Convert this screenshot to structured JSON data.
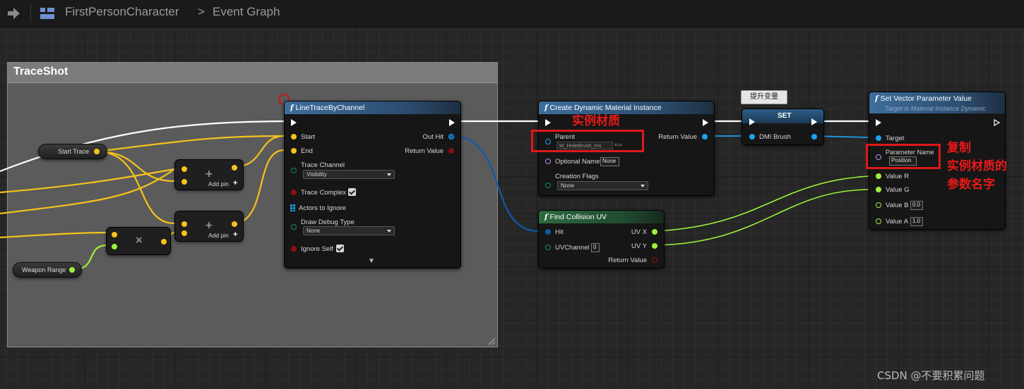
{
  "topbar": {
    "breadcrumb_blueprint": "FirstPersonCharacter",
    "breadcrumb_separator": ">",
    "breadcrumb_graph": "Event Graph"
  },
  "comment_box": {
    "title": "TraceShot"
  },
  "nodes": {
    "start_trace": {
      "label": "Start Trace"
    },
    "weapon_range": {
      "label": "Weapon Range"
    },
    "add_1": {
      "add_pin": "Add pin",
      "symbol": "+",
      "plus": "+"
    },
    "add_2": {
      "add_pin": "Add pin",
      "symbol": "+",
      "plus": "+"
    },
    "multiply": {
      "symbol": "×"
    },
    "line_trace": {
      "func_glyph": "f",
      "title": "LineTraceByChannel",
      "start": "Start",
      "end": "End",
      "trace_channel": "Trace Channel",
      "trace_channel_value": "Visibility",
      "trace_complex": "Trace Complex",
      "actors_to_ignore": "Actors to Ignore",
      "draw_debug_type": "Draw Debug Type",
      "draw_debug_value": "None",
      "ignore_self": "Ignore Self",
      "out_hit": "Out Hit",
      "return_value": "Return Value",
      "expand_glyph": "▼"
    },
    "create_dmi": {
      "func_glyph": "f",
      "title": "Create Dynamic Material Instance",
      "parent": "Parent",
      "parent_value": "M_HoleBrush_Ins",
      "optional_name": "Optional Name",
      "optional_name_value": "None",
      "creation_flags": "Creation Flags",
      "creation_flags_value": "None",
      "return_value": "Return Value"
    },
    "set_node": {
      "title": "SET",
      "var": "DMI Brush"
    },
    "find_uv": {
      "func_glyph": "f",
      "title": "Find Collision UV",
      "hit": "Hit",
      "uv_channel": "UVChannel",
      "uv_channel_value": "0",
      "uv_x": "UV X",
      "uv_y": "UV Y",
      "return_value": "Return Value"
    },
    "set_vector": {
      "func_glyph": "f",
      "title": "Set Vector Parameter Value",
      "subtitle": "Target is Material Instance Dynamic",
      "target": "Target",
      "parameter_name": "Parameter Name",
      "parameter_name_value": "Position",
      "value_r": "Value R",
      "value_g": "Value G",
      "value_b": "Value B",
      "value_b_value": "0.0",
      "value_a": "Value A",
      "value_a_value": "1.0"
    }
  },
  "tooltip": "提升变量",
  "annotations": {
    "instance_material": "实例材质",
    "copy_line1": "复制",
    "copy_line2": "实例材质的",
    "copy_line3": "参数名字"
  },
  "watermark": "CSDN @不要积累问题",
  "colors": {
    "exec": "#ffffff",
    "vector": "#f5c21c",
    "float": "#9ef03c",
    "object": "#1aa3f0",
    "struct": "#0b5ca8",
    "bool": "#8c0f0f",
    "name": "#c487f5",
    "byte": "#0e8c7a",
    "annotation": "#e01818"
  }
}
